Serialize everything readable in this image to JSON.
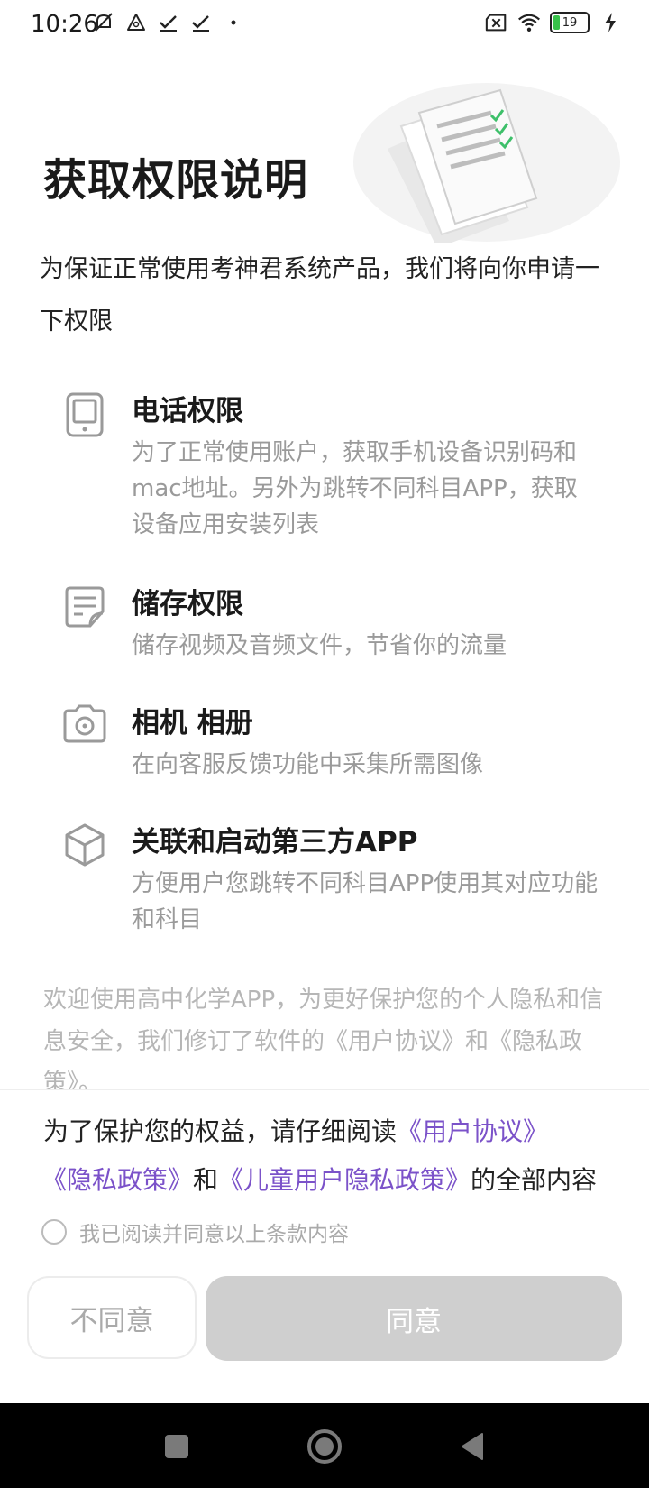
{
  "status_bar": {
    "time": "10:26",
    "battery_level": "19",
    "left_icons": [
      "mute-icon",
      "notification-icon",
      "check-icon",
      "check-icon",
      "dot-icon"
    ],
    "right_icons": [
      "sim-off-icon",
      "wifi-icon",
      "battery-icon",
      "charging-icon"
    ]
  },
  "header": {
    "title": "获取权限说明",
    "intro": "为保证正常使用考神君系统产品，我们将向你申请一下权限"
  },
  "permissions": [
    {
      "icon": "phone-icon",
      "title": "电话权限",
      "description": "为了正常使用账户，获取手机设备识别码和mac地址。另外为跳转不同科目APP，获取设备应用安装列表"
    },
    {
      "icon": "storage-icon",
      "title": "储存权限",
      "description": "储存视频及音频文件，节省你的流量"
    },
    {
      "icon": "camera-icon",
      "title": "相机 相册",
      "description": "在向客服反馈功能中采集所需图像"
    },
    {
      "icon": "cube-icon",
      "title": "关联和启动第三方APP",
      "description": "方便用户您跳转不同科目APP使用其对应功能和科目"
    }
  ],
  "notice": {
    "text": "欢迎使用高中化学APP，为更好保护您的个人隐私和信息安全，我们修订了软件的《用户协议》和《隐私政策》。"
  },
  "bottom_sheet": {
    "prefix": "为了保护您的权益，请仔细阅读",
    "user_agreement_link": "《用户协议》",
    "privacy_policy_link": "《隐私政策》",
    "and_word": "和",
    "children_privacy_link": "《儿童用户隐私政策》",
    "suffix": "的全部内容",
    "consent_label": "我已阅读并同意以上条款内容",
    "disagree_button": "不同意",
    "agree_button": "同意"
  },
  "colors": {
    "link": "#7b52c9",
    "agree_button_bg": "#cfcfcf",
    "muted_text": "#9a9a9a"
  }
}
